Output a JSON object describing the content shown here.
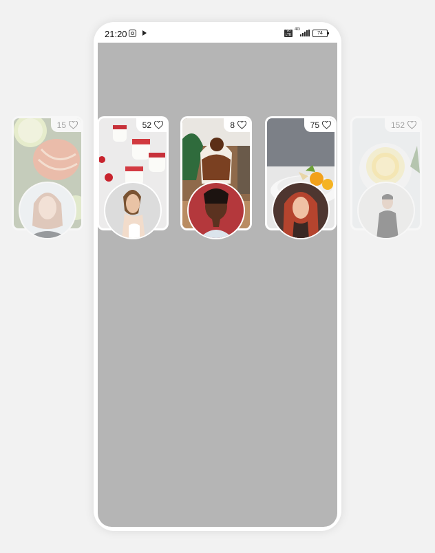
{
  "status_bar": {
    "time": "21:20",
    "network_badge": "4G",
    "volte_badge": "Vo LTE",
    "battery": "74"
  },
  "cards": [
    {
      "likes": "15",
      "food": "salmon",
      "person": "blonde-woman",
      "faded": true
    },
    {
      "likes": "52",
      "food": "desserts",
      "person": "woman-profile",
      "faded": false
    },
    {
      "likes": "8",
      "food": "sundae",
      "person": "dark-woman",
      "faded": false
    },
    {
      "likes": "75",
      "food": "plate",
      "person": "redhead-woman",
      "faded": false
    },
    {
      "likes": "152",
      "food": "lemon-drink",
      "person": "man-coat",
      "faded": true
    }
  ],
  "colors": {
    "page_background": "#f2f2f2",
    "screen_background": "#b5b5b5",
    "phone_frame": "#ffffff"
  }
}
